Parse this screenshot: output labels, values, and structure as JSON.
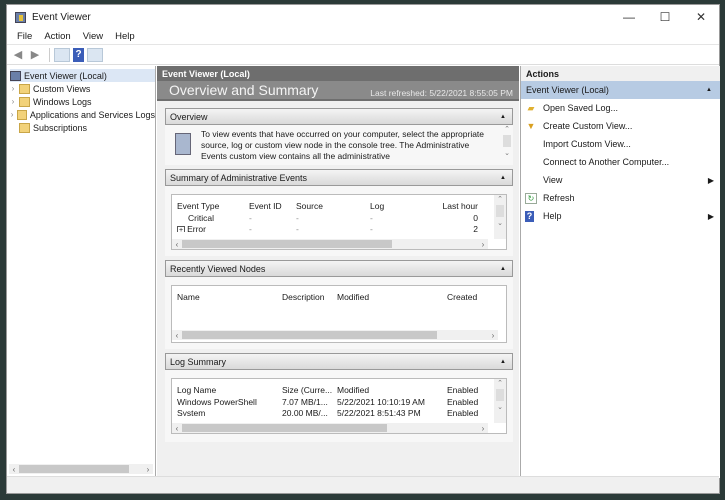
{
  "window": {
    "title": "Event Viewer",
    "controls": {
      "minimize": "—",
      "maximize": "☐",
      "close": "✕"
    }
  },
  "menu": [
    "File",
    "Action",
    "View",
    "Help"
  ],
  "toolbar": {
    "back": "◀",
    "forward": "▶",
    "help": "?"
  },
  "tree": {
    "root": "Event Viewer (Local)",
    "items": [
      {
        "label": "Custom Views",
        "expandable": true
      },
      {
        "label": "Windows Logs",
        "expandable": true
      },
      {
        "label": "Applications and Services Logs",
        "expandable": true
      },
      {
        "label": "Subscriptions",
        "expandable": false
      }
    ]
  },
  "center": {
    "header": "Event Viewer (Local)",
    "title": "Overview and Summary",
    "last_refreshed": "Last refreshed: 5/22/2021 8:55:05 PM",
    "overview": {
      "title": "Overview",
      "text": "To view events that have occurred on your computer, select the appropriate source, log or custom view node in the console tree. The Administrative Events custom view contains all the administrative"
    },
    "admin_events": {
      "title": "Summary of Administrative Events",
      "columns": [
        "Event Type",
        "Event ID",
        "Source",
        "Log",
        "Last hour"
      ],
      "rows": [
        [
          "Critical",
          "-",
          "-",
          "-",
          "0"
        ],
        [
          "Error",
          "-",
          "-",
          "-",
          "2"
        ]
      ]
    },
    "recent_nodes": {
      "title": "Recently Viewed Nodes",
      "columns": [
        "Name",
        "Description",
        "Modified",
        "Created"
      ]
    },
    "log_summary": {
      "title": "Log Summary",
      "columns": [
        "Log Name",
        "Size (Curre...",
        "Modified",
        "Enabled"
      ],
      "rows": [
        [
          "Windows PowerShell",
          "7.07 MB/1...",
          "5/22/2021 10:10:19 AM",
          "Enabled"
        ],
        [
          "System",
          "20.00 MB/...",
          "5/22/2021 8:51:43 PM",
          "Enabled"
        ]
      ]
    }
  },
  "actions": {
    "header": "Actions",
    "group": "Event Viewer (Local)",
    "items": [
      {
        "label": "Open Saved Log...",
        "icon": "folder-icon"
      },
      {
        "label": "Create Custom View...",
        "icon": "filter-icon"
      },
      {
        "label": "Import Custom View...",
        "icon": ""
      },
      {
        "label": "Connect to Another Computer...",
        "icon": ""
      },
      {
        "label": "View",
        "icon": "",
        "submenu": true
      },
      {
        "label": "Refresh",
        "icon": "refresh-icon"
      },
      {
        "label": "Help",
        "icon": "help-icon",
        "submenu": true
      }
    ]
  }
}
